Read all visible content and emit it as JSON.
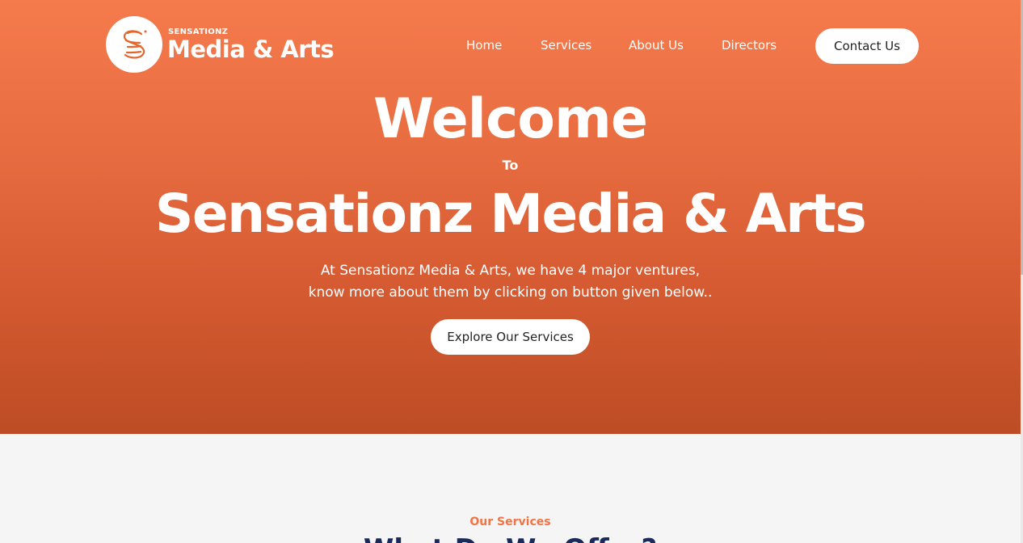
{
  "header": {
    "logo_small": "SENSATIONZ",
    "logo_big": "Media & Arts",
    "nav": [
      {
        "label": "Home"
      },
      {
        "label": "Services"
      },
      {
        "label": "About Us"
      },
      {
        "label": "Directors"
      }
    ],
    "contact_label": "Contact Us"
  },
  "hero": {
    "welcome": "Welcome",
    "to": "To",
    "company": "Sensationz Media & Arts",
    "desc_line1": "At Sensationz Media & Arts, we have 4 major ventures,",
    "desc_line2": "know more about them by clicking on button given below..",
    "cta_label": "Explore Our Services"
  },
  "services": {
    "label": "Our Services",
    "heading": "What Do We Offer?"
  },
  "colors": {
    "hero_top": "#f57a4c",
    "hero_bottom": "#bd4c24",
    "accent": "#f07445",
    "heading": "#1a2a5a"
  }
}
